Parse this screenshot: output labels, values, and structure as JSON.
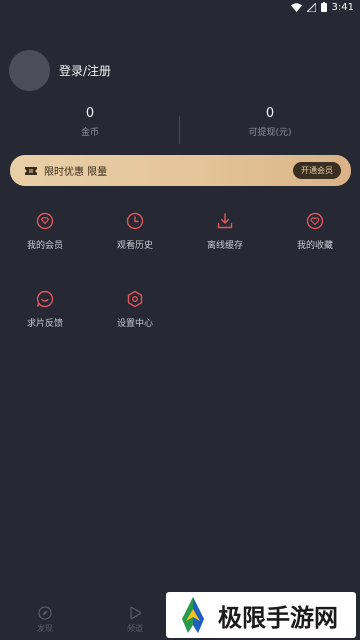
{
  "status_bar": {
    "time": "3:41"
  },
  "profile": {
    "login_label": "登录/注册"
  },
  "stats": [
    {
      "value": "0",
      "label": "金币"
    },
    {
      "value": "0",
      "label": "可提现(元)"
    }
  ],
  "vip_banner": {
    "text": "限时优惠 限量",
    "button_label": "开通会员"
  },
  "menu": [
    {
      "label": "我的会员",
      "icon": "diamond-icon"
    },
    {
      "label": "观看历史",
      "icon": "clock-icon"
    },
    {
      "label": "离线缓存",
      "icon": "download-icon"
    },
    {
      "label": "我的收藏",
      "icon": "heart-icon"
    },
    {
      "label": "求片反馈",
      "icon": "chat-smile-icon"
    },
    {
      "label": "设置中心",
      "icon": "hexagon-settings-icon"
    }
  ],
  "bottom_nav": [
    {
      "label": "发现",
      "icon": "compass-icon"
    },
    {
      "label": "频道",
      "icon": "play-icon"
    }
  ],
  "watermark": {
    "text": "极限手游网"
  },
  "colors": {
    "background": "#262833",
    "accent": "#e0555a",
    "vip_gold": "#e9cfa7"
  }
}
